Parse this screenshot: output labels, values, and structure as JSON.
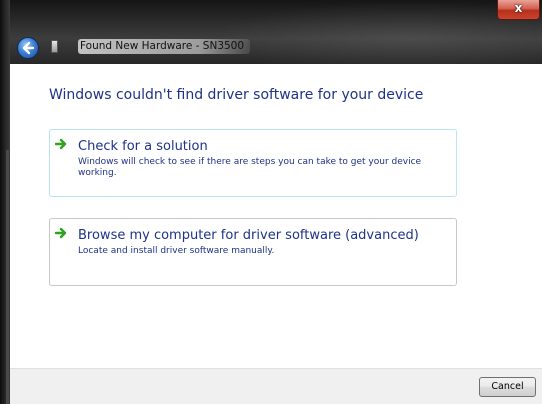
{
  "window": {
    "title": "Found New Hardware - SN3500",
    "close_label": "x"
  },
  "icons": {
    "back": "back-arrow-icon",
    "app": "hardware-device-icon",
    "option_arrow": "green-arrow-icon",
    "close": "close-icon"
  },
  "main": {
    "heading": "Windows couldn't find driver software for your device",
    "options": [
      {
        "title": "Check for a solution",
        "description": "Windows will check to see if there are steps you can take to get your device working."
      },
      {
        "title": "Browse my computer for driver software (advanced)",
        "description": "Locate and install driver software manually."
      }
    ]
  },
  "footer": {
    "cancel_label": "Cancel"
  },
  "colors": {
    "link_blue": "#1e3287",
    "arrow_green": "#2fa31f",
    "option_border_highlight": "#b9e4f2",
    "option_border": "#c8c8c8",
    "footer_bg": "#f0f0f0"
  }
}
